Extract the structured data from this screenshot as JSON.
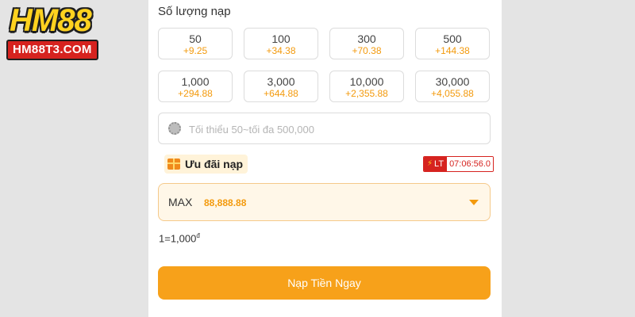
{
  "logo": {
    "main": "HM88",
    "sub": "HM88T3.COM"
  },
  "section_title": "Số lượng nạp",
  "amounts": [
    {
      "amount": "50",
      "bonus": "+9.25"
    },
    {
      "amount": "100",
      "bonus": "+34.38"
    },
    {
      "amount": "300",
      "bonus": "+70.38"
    },
    {
      "amount": "500",
      "bonus": "+144.38"
    },
    {
      "amount": "1,000",
      "bonus": "+294.88"
    },
    {
      "amount": "3,000",
      "bonus": "+644.88"
    },
    {
      "amount": "10,000",
      "bonus": "+2,355.88"
    },
    {
      "amount": "30,000",
      "bonus": "+4,055.88"
    }
  ],
  "amount_input": {
    "placeholder": "Tối thiểu 50~tối đa 500,000",
    "value": ""
  },
  "promo": {
    "label": "Ưu đãi nạp",
    "icon": "gift-icon"
  },
  "timer": {
    "badge": "LT",
    "time": "07:06:56.0"
  },
  "offer_select": {
    "prefix": "MAX",
    "value": "88,888.88"
  },
  "rate": {
    "text": "1=1,000",
    "currency": "đ"
  },
  "submit_label": "Nạp Tiền Ngay",
  "colors": {
    "accent": "#f7a11a",
    "bonus": "#f39a0d",
    "timer": "#d6231f"
  }
}
